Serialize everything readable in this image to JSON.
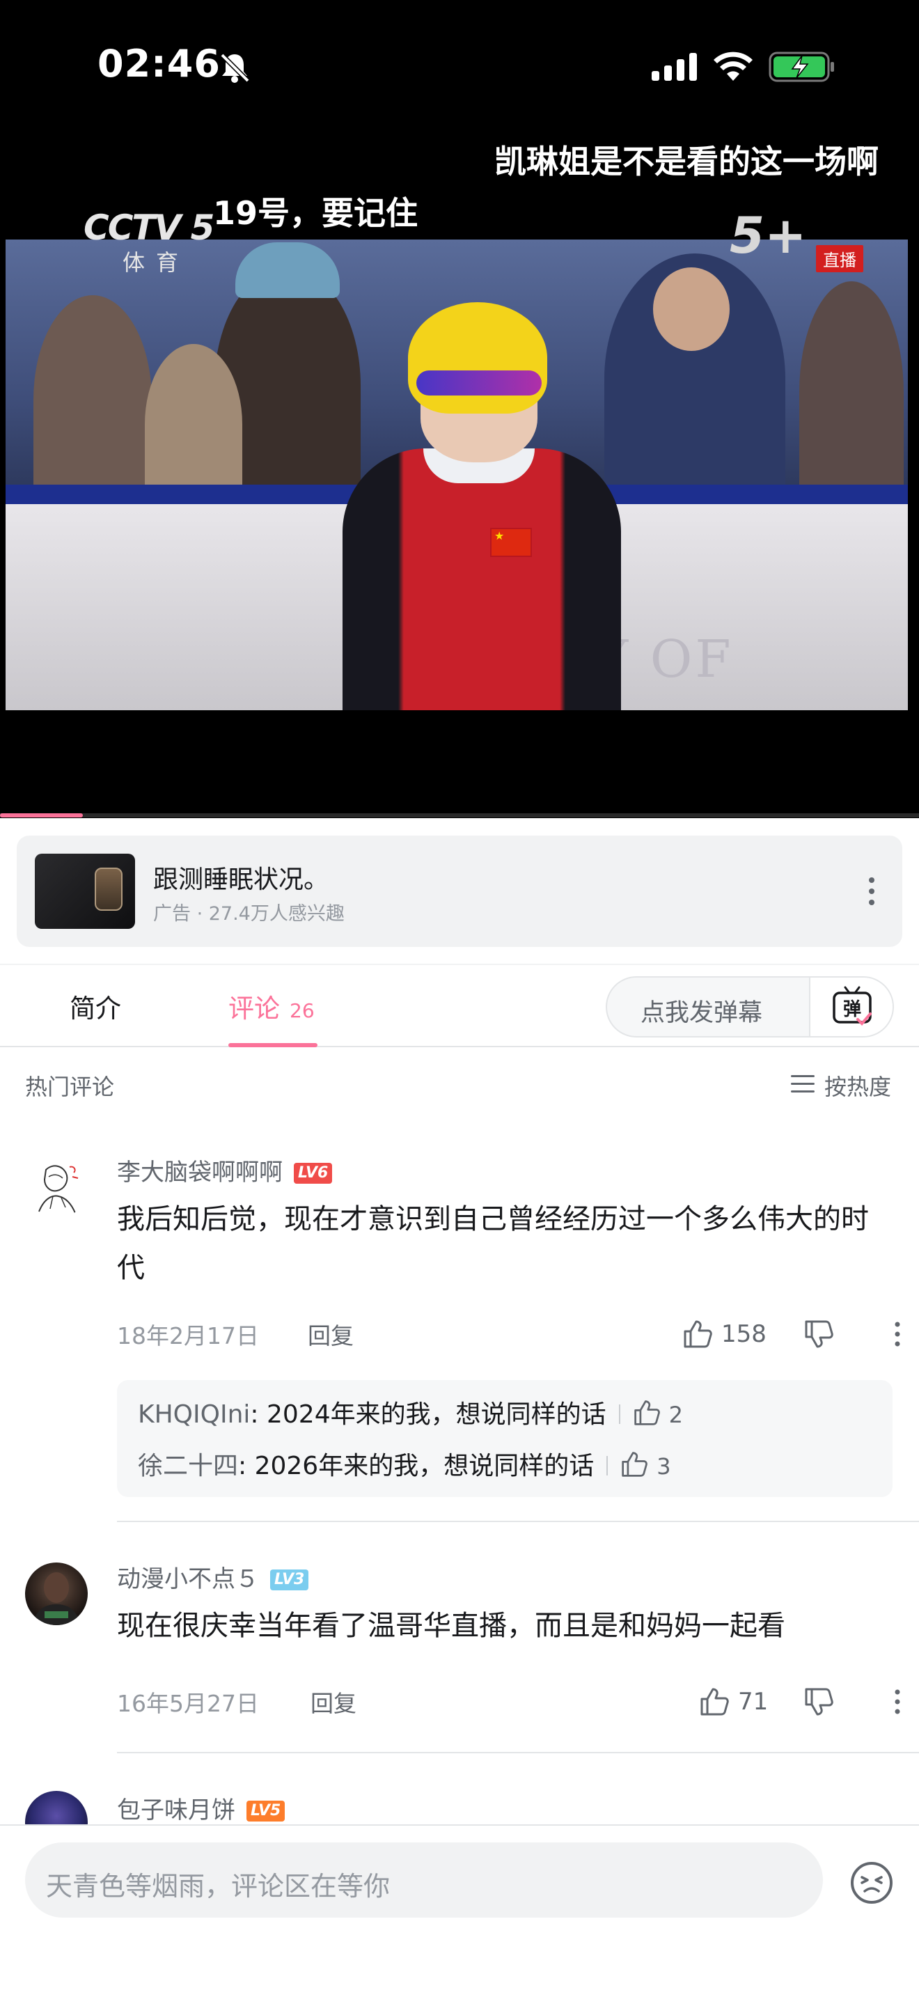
{
  "status_bar": {
    "time": "02:46",
    "icons": [
      "bell-slash-icon",
      "signal-icon",
      "wifi-icon",
      "battery-charging-icon"
    ]
  },
  "video": {
    "danmaku": [
      "凯琳姐是不是看的这一场啊",
      "19号，要记住"
    ],
    "overlay": {
      "channel": "CCTV 5",
      "channel_sub": "体育",
      "live": "直播",
      "plus_logo": "5+",
      "board_text": "TY OF"
    },
    "progress": 0.09
  },
  "ad": {
    "title": "跟测睡眠状况。",
    "subtitle": "广告 · 27.4万人感兴趣"
  },
  "tabs": {
    "intro": "简介",
    "comments": "评论",
    "comments_count": "26",
    "danmaku_placeholder": "点我发弹幕",
    "danmaku_button": "弹"
  },
  "comments_header": {
    "title": "热门评论",
    "sort": "按热度"
  },
  "comments": [
    {
      "user": "李大脑袋啊啊啊",
      "level": "LV6",
      "text": "我后知后觉，现在才意识到自己曾经经历过一个多么伟大的时代",
      "date": "18年2月17日",
      "reply": "回复",
      "likes": "158",
      "replies": [
        {
          "user": "KHQIQIni",
          "text": ": 2024年来的我，想说同样的话",
          "likes": "2"
        },
        {
          "user": "徐二十四",
          "text": ": 2026年来的我，想说同样的话",
          "likes": "3"
        }
      ]
    },
    {
      "user": "动漫小不点５",
      "level": "LV3",
      "text": "现在很庆幸当年看了温哥华直播，而且是和妈妈一起看",
      "date": "16年5月27日",
      "reply": "回复",
      "likes": "71"
    },
    {
      "user": "包子味月饼",
      "level": "LV5"
    }
  ],
  "bottom": {
    "placeholder": "天青色等烟雨，评论区在等你"
  },
  "colors": {
    "accent": "#fb7299",
    "text_secondary": "#61666d",
    "text_muted": "#9499a0"
  }
}
